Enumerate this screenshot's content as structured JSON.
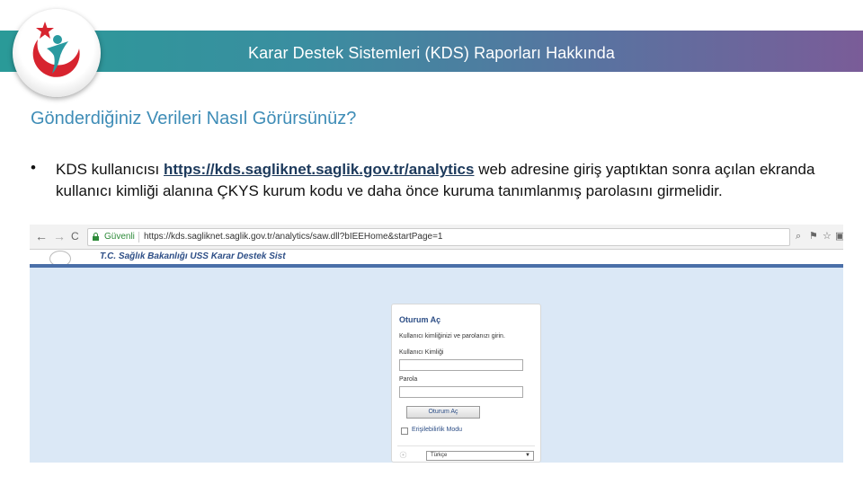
{
  "header": {
    "title": "Karar Destek Sistemleri (KDS) Raporları Hakkında"
  },
  "colors": {
    "banner_start": "#2a9a98",
    "banner_end": "#7a5c98",
    "heading": "#3f8db7"
  },
  "main": {
    "heading": "Gönderdiğiniz Verileri Nasıl Görürsünüz?",
    "bullet_marker": "•",
    "paragraph_before_link": "KDS kullanıcısı ",
    "link_text": "https://kds.sagliknet.saglik.gov.tr/analytics",
    "paragraph_after_link": " web adresine giriş yaptıktan sonra açılan ekranda kullanıcı kimliği alanına ÇKYS kurum kodu ve daha önce kuruma tanımlanmış parolasını girmelidir."
  },
  "screenshot": {
    "browser": {
      "back_glyph": "←",
      "forward_glyph": "→",
      "reload_glyph": "C",
      "security_label": "Güvenli",
      "url": "https://kds.sagliknet.saglik.gov.tr/analytics/saw.dll?bIEEHome&startPage=1",
      "icons": [
        "zoom-icon",
        "pin-icon",
        "star-icon",
        "extension-icon"
      ]
    },
    "site": {
      "title": "T.C. Sağlık Bakanlığı USS Karar Destek Sist"
    },
    "login": {
      "title": "Oturum Aç",
      "instruction": "Kullanıcı kimliğinizi ve parolanızı girin.",
      "user_label": "Kullanıcı Kimliği",
      "password_label": "Parola",
      "button_label": "Oturum Aç",
      "accessibility_label": "Erişilebilirlik Modu",
      "language_value": "Türkçe"
    }
  }
}
